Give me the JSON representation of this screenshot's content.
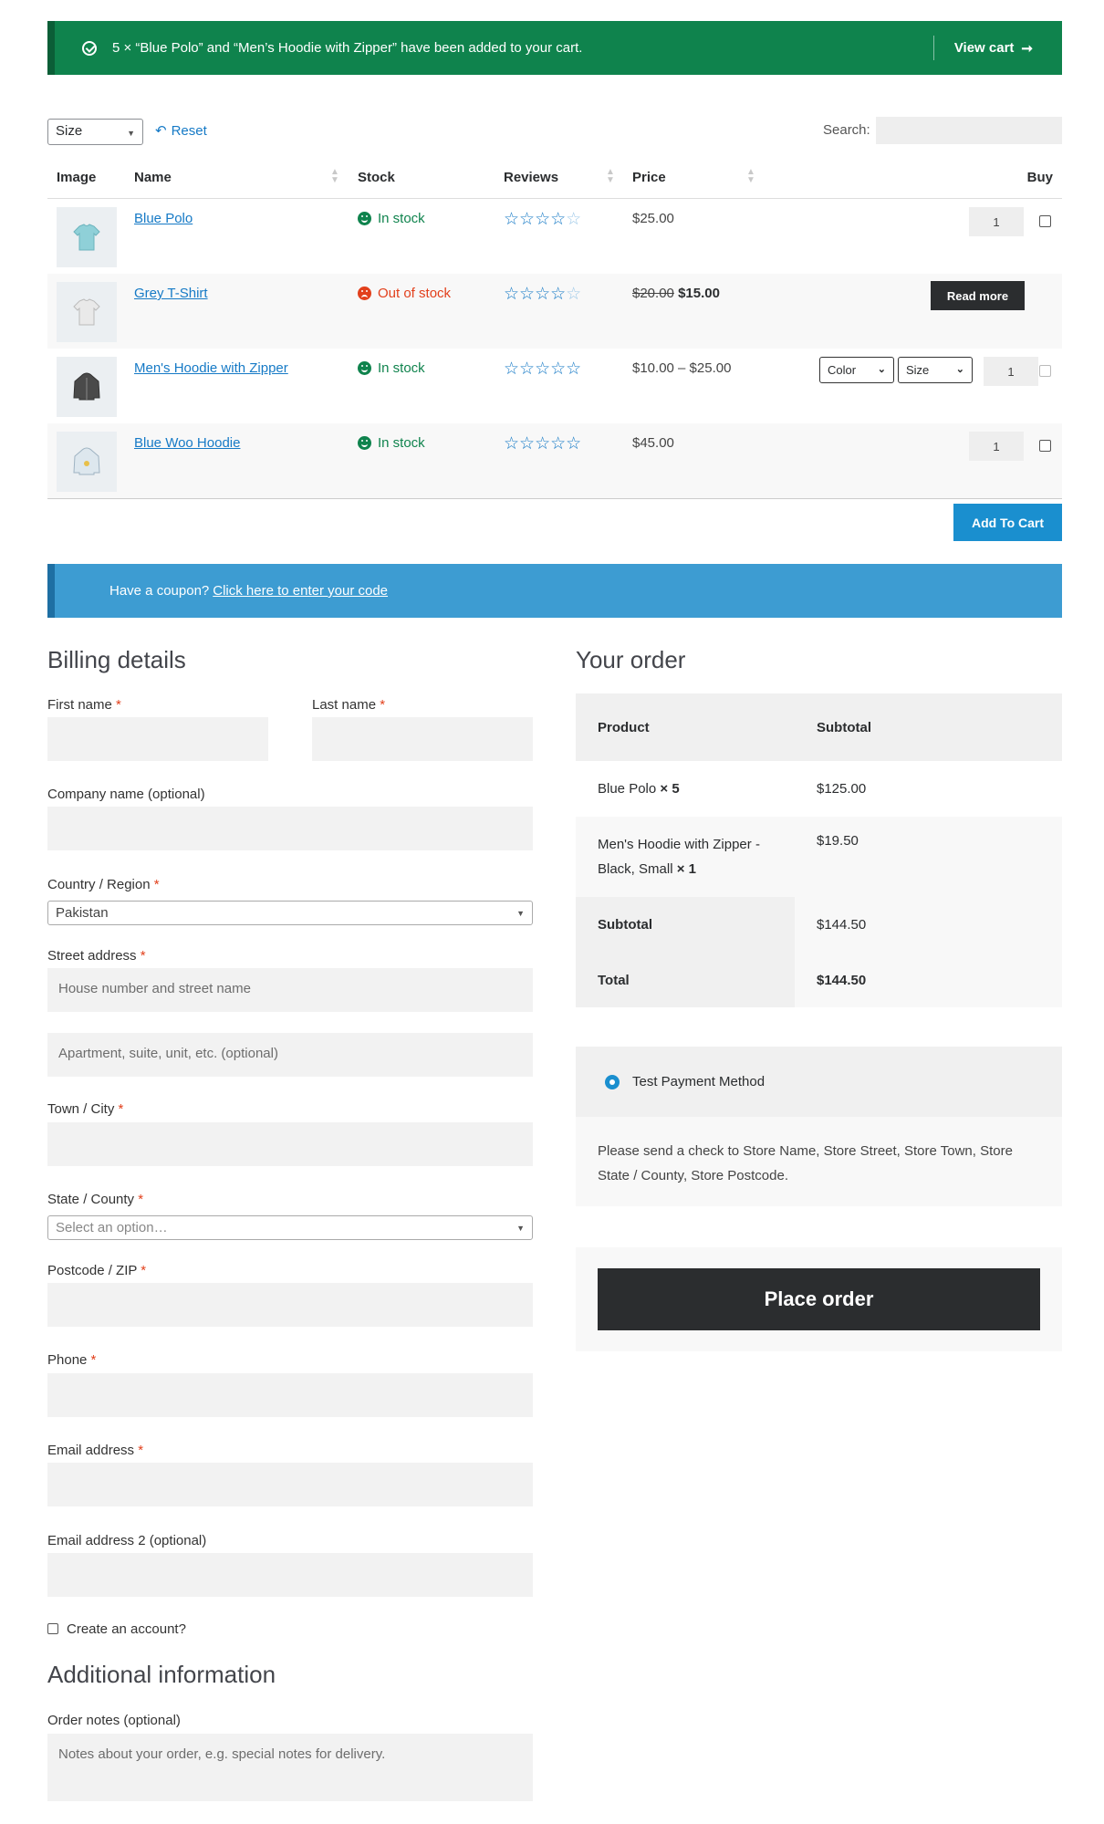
{
  "notice": {
    "message": "5 × “Blue Polo” and “Men’s Hoodie with Zipper” have been added to your cart.",
    "view_cart": "View cart",
    "icon": "check-circle-icon"
  },
  "filters": {
    "size_select": "Size",
    "reset": "Reset",
    "search_label": "Search:"
  },
  "table": {
    "headers": {
      "image": "Image",
      "name": "Name",
      "stock": "Stock",
      "reviews": "Reviews",
      "price": "Price",
      "buy": "Buy"
    },
    "rows": [
      {
        "name": "Blue Polo",
        "stock": "In stock",
        "stock_state": "in",
        "price": "$25.00",
        "qty": "1",
        "rating": 4.5
      },
      {
        "name": "Grey T-Shirt",
        "stock": "Out of stock",
        "stock_state": "out",
        "price_old": "$20.00",
        "price_new": "$15.00",
        "action": "Read more",
        "rating": 4.5
      },
      {
        "name": "Men's Hoodie with Zipper",
        "stock": "In stock",
        "stock_state": "in",
        "price": "$10.00 – $25.00",
        "color_select": "Color",
        "size_select": "Size",
        "qty": "1",
        "rating": 5
      },
      {
        "name": "Blue Woo Hoodie",
        "stock": "In stock",
        "stock_state": "in",
        "price": "$45.00",
        "qty": "1",
        "rating": 5
      }
    ],
    "add_to_cart": "Add To Cart"
  },
  "coupon": {
    "text": "Have a coupon?",
    "link": "Click here to enter your code"
  },
  "billing": {
    "title": "Billing details",
    "first_name": "First name",
    "last_name": "Last name",
    "company": "Company name (optional)",
    "country": "Country / Region",
    "country_value": "Pakistan",
    "street": "Street address",
    "street_ph1": "House number and street name",
    "street_ph2": "Apartment, suite, unit, etc. (optional)",
    "town": "Town / City",
    "state": "State / County",
    "state_ph": "Select an option…",
    "postcode": "Postcode / ZIP",
    "phone": "Phone",
    "email": "Email address",
    "email2": "Email address 2 (optional)",
    "create_account": "Create an account?",
    "required_mark": "*"
  },
  "additional": {
    "title": "Additional information",
    "notes_label": "Order notes (optional)",
    "notes_ph": "Notes about your order, e.g. special notes for delivery."
  },
  "order": {
    "title": "Your order",
    "col_product": "Product",
    "col_subtotal": "Subtotal",
    "item1_name": "Blue Polo",
    "item1_qty": "× 5",
    "item1_sub": "$125.00",
    "item2_name": "Men's Hoodie with Zipper - Black, Small",
    "item2_qty": "× 1",
    "item2_sub": "$19.50",
    "subtotal_label": "Subtotal",
    "subtotal_value": "$144.50",
    "total_label": "Total",
    "total_value": "$144.50"
  },
  "payment": {
    "method": "Test Payment Method",
    "description": "Please send a check to Store Name, Store Street, Store Town, Store State / County, Store Postcode.",
    "place_order": "Place order"
  },
  "colors": {
    "notice": "#0f834d",
    "coupon": "#3d9cd2",
    "link": "#167ac6",
    "button_dark": "#2b2d2f",
    "button_blue": "#1a8fcf"
  }
}
